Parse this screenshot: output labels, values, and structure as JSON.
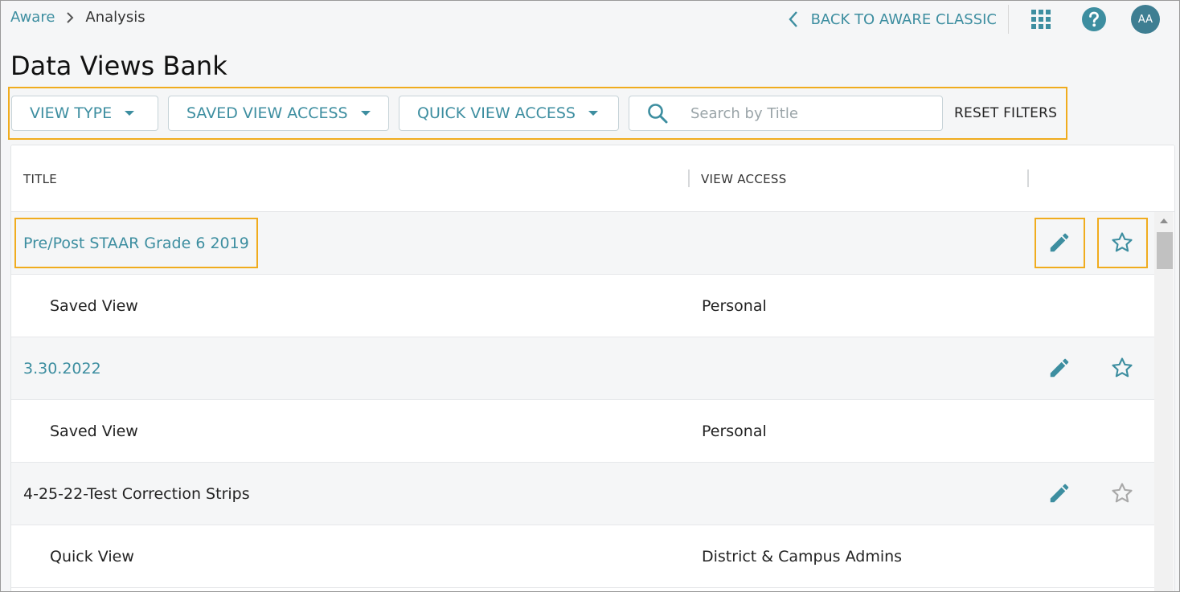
{
  "breadcrumb": {
    "root": "Aware",
    "current": "Analysis"
  },
  "header": {
    "back_label": "BACK TO AWARE CLASSIC",
    "avatar_initials": "AA"
  },
  "page": {
    "title": "Data Views Bank"
  },
  "filters": {
    "view_type": "VIEW TYPE",
    "saved_view_access": "SAVED VIEW ACCESS",
    "quick_view_access": "QUICK VIEW ACCESS",
    "search_placeholder": "Search by Title",
    "reset": "RESET FILTERS"
  },
  "table": {
    "columns": [
      "TITLE",
      "VIEW ACCESS"
    ],
    "rows": [
      {
        "title": "Pre/Post STAAR Grade 6 2019",
        "type": "Saved View",
        "access": "Personal",
        "linked": true,
        "favorite_color": "#3d8ea0"
      },
      {
        "title": "3.30.2022",
        "type": "Saved View",
        "access": "Personal",
        "linked": true,
        "favorite_color": "#3d8ea0"
      },
      {
        "title": "4-25-22-Test Correction Strips",
        "type": "Quick View",
        "access": "District & Campus Admins",
        "linked": false,
        "favorite_color": "#a9a9a9"
      }
    ]
  },
  "colors": {
    "accent": "#3d8ea0",
    "highlight": "#f0ac1e",
    "avatar_bg": "#3e7e92"
  }
}
